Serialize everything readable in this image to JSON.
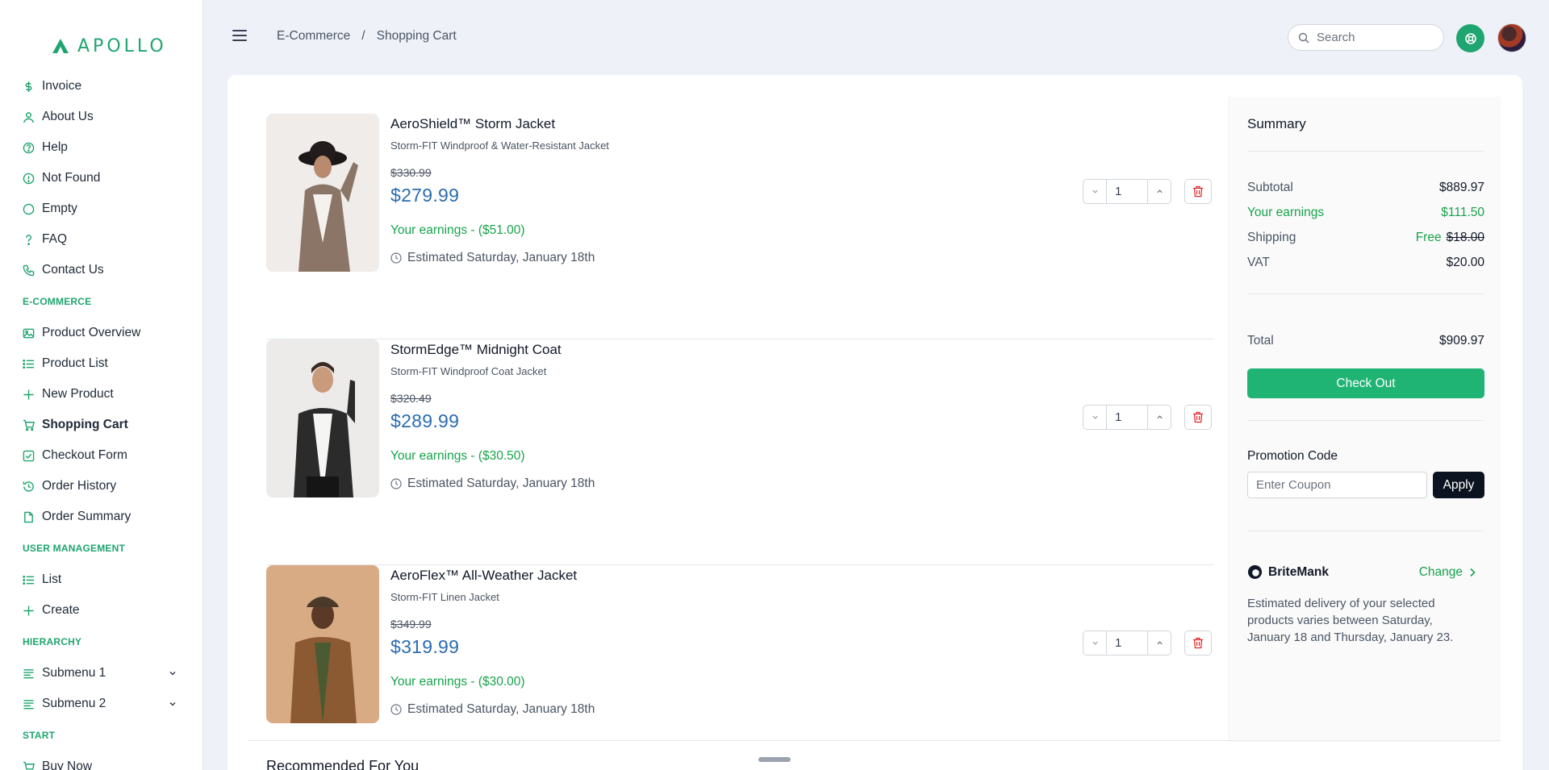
{
  "brand": {
    "name": "APOLLO"
  },
  "sidebar": {
    "items_top": [
      {
        "label": "Invoice",
        "icon": "dollar-icon"
      },
      {
        "label": "About Us",
        "icon": "user-icon"
      },
      {
        "label": "Help",
        "icon": "help-circle-icon"
      },
      {
        "label": "Not Found",
        "icon": "alert-circle-icon"
      },
      {
        "label": "Empty",
        "icon": "circle-icon"
      },
      {
        "label": "FAQ",
        "icon": "question-icon"
      },
      {
        "label": "Contact Us",
        "icon": "phone-icon"
      }
    ],
    "section_ecommerce": "E-COMMERCE",
    "items_ecommerce": [
      {
        "label": "Product Overview",
        "icon": "image-icon"
      },
      {
        "label": "Product List",
        "icon": "list-icon"
      },
      {
        "label": "New Product",
        "icon": "plus-icon"
      },
      {
        "label": "Shopping Cart",
        "icon": "cart-icon"
      },
      {
        "label": "Checkout Form",
        "icon": "check-square-icon"
      },
      {
        "label": "Order History",
        "icon": "history-icon"
      },
      {
        "label": "Order Summary",
        "icon": "file-icon"
      }
    ],
    "section_user": "USER MANAGEMENT",
    "items_user": [
      {
        "label": "List",
        "icon": "list-icon"
      },
      {
        "label": "Create",
        "icon": "plus-icon"
      }
    ],
    "section_hierarchy": "HIERARCHY",
    "items_hierarchy": [
      {
        "label": "Submenu 1",
        "icon": "menu-lines-icon"
      },
      {
        "label": "Submenu 2",
        "icon": "menu-lines-icon"
      }
    ],
    "section_start": "START",
    "items_start": [
      {
        "label": "Buy Now",
        "icon": "cart-icon"
      }
    ]
  },
  "header": {
    "breadcrumb": [
      "E-Commerce",
      "/",
      "Shopping Cart"
    ],
    "search_placeholder": "Search"
  },
  "cart": {
    "items": [
      {
        "name": "AeroShield™ Storm Jacket",
        "subtitle": "Storm-FIT Windproof & Water-Resistant Jacket",
        "old_price": "$330.99",
        "price": "$279.99",
        "earnings": "Your earnings - ($51.00)",
        "eta": "Estimated Saturday, January 18th",
        "qty": "1"
      },
      {
        "name": "StormEdge™ Midnight Coat",
        "subtitle": "Storm-FIT Windproof Coat Jacket",
        "old_price": "$320.49",
        "price": "$289.99",
        "earnings": "Your earnings - ($30.50)",
        "eta": "Estimated Saturday, January 18th",
        "qty": "1"
      },
      {
        "name": "AeroFlex™ All-Weather Jacket",
        "subtitle": "Storm-FIT Linen Jacket",
        "old_price": "$349.99",
        "price": "$319.99",
        "earnings": "Your earnings - ($30.00)",
        "eta": "Estimated Saturday, January 18th",
        "qty": "1"
      }
    ]
  },
  "summary": {
    "title": "Summary",
    "subtotal_label": "Subtotal",
    "subtotal": "$889.97",
    "earnings_label": "Your earnings",
    "earnings": "$111.50",
    "shipping_label": "Shipping",
    "shipping_free": "Free",
    "shipping_old": "$18.00",
    "vat_label": "VAT",
    "vat": "$20.00",
    "total_label": "Total",
    "total": "$909.97",
    "checkout_label": "Check Out",
    "promo_label": "Promotion Code",
    "coupon_placeholder": "Enter Coupon",
    "apply_label": "Apply",
    "carrier": "BriteMank",
    "change_label": "Change",
    "delivery_note": "Estimated delivery of your selected products varies between Saturday, January 18 and Thursday, January 23."
  },
  "recommended_title": "Recommended For You",
  "colors": {
    "accent": "#1fa56f",
    "price": "#2b6cb0",
    "earnings": "#16a34a",
    "danger": "#dc2626"
  }
}
